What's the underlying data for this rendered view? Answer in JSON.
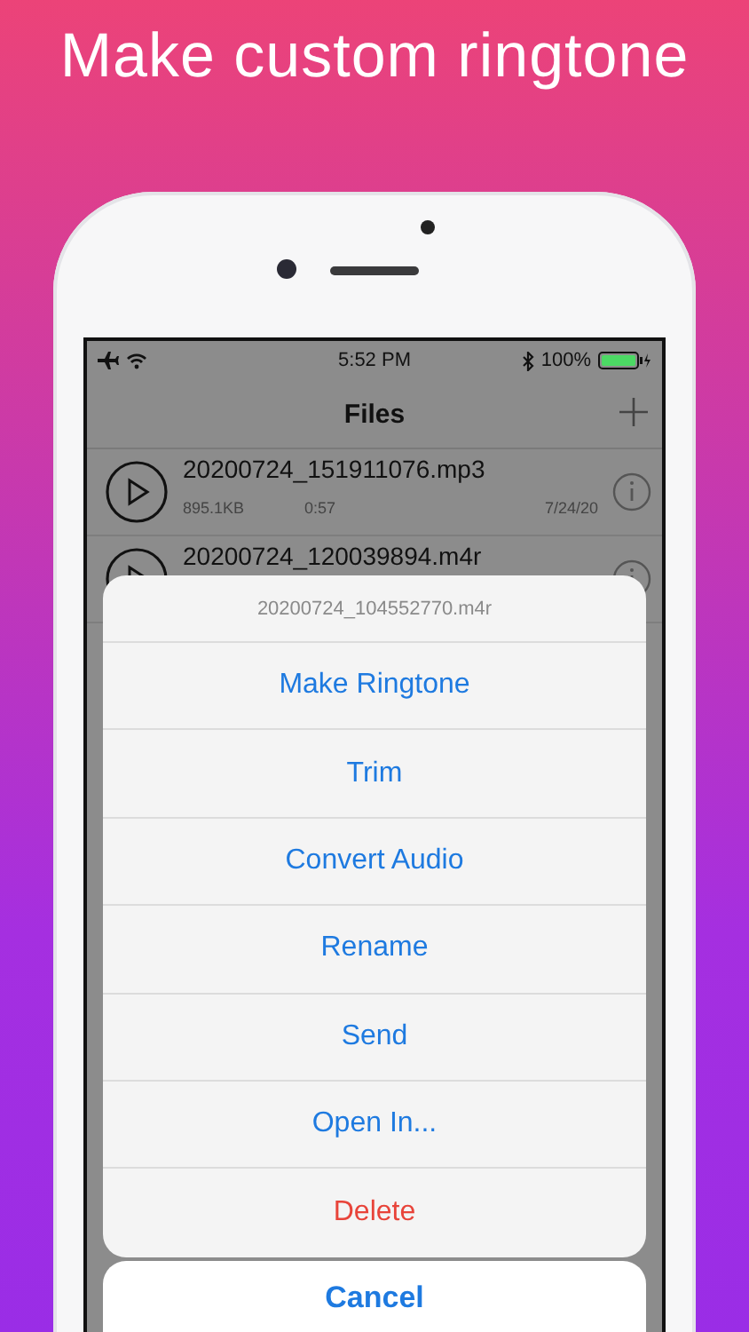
{
  "headline": "Make custom ringtone",
  "status_bar": {
    "time": "5:52 PM",
    "battery": "100%"
  },
  "nav": {
    "title": "Files"
  },
  "files": [
    {
      "name": "20200724_151911076.mp3",
      "size": "895.1KB",
      "duration": "0:57",
      "date": "7/24/20"
    },
    {
      "name": "20200724_120039894.m4r"
    }
  ],
  "action_sheet": {
    "title": "20200724_104552770.m4r",
    "actions": [
      {
        "label": "Make Ringtone",
        "kind": "default"
      },
      {
        "label": "Trim",
        "kind": "default"
      },
      {
        "label": "Convert Audio",
        "kind": "default"
      },
      {
        "label": "Rename",
        "kind": "default"
      },
      {
        "label": "Send",
        "kind": "default"
      },
      {
        "label": "Open In...",
        "kind": "default"
      },
      {
        "label": "Delete",
        "kind": "destructive"
      }
    ],
    "cancel": "Cancel"
  }
}
